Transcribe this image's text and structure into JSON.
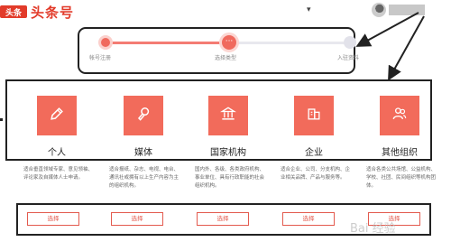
{
  "header": {
    "logo_badge": "头条",
    "logo_text": "头条号",
    "caret": "▾"
  },
  "stepper": {
    "steps": [
      {
        "label": "帐号注册",
        "status": "done"
      },
      {
        "label": "选择类型",
        "status": "current",
        "icon": "···"
      },
      {
        "label": "入驻资料",
        "status": "pending"
      }
    ]
  },
  "categories": [
    {
      "name": "个人",
      "icon": "pencil-icon",
      "desc": "适合垂直领域专家、意见领袖、评论家及自媒体人士申请。"
    },
    {
      "name": "媒体",
      "icon": "microphone-icon",
      "desc": "适合报纸、杂志、电视、电台、通讯社或拥有以上生产内容为主的组织机构。"
    },
    {
      "name": "国家机构",
      "icon": "government-building-icon",
      "desc": "国内外、各级、各类政府机构、事业单位、具有行政职能的社会组织机构。"
    },
    {
      "name": "企业",
      "icon": "company-building-icon",
      "desc": "适合企业、公司、分支机构、企业相关品牌、产品与服务等。"
    },
    {
      "name": "其他组织",
      "icon": "group-icon",
      "desc": "适合各类公共场馆、公益机构、学校、社团、民间组织等机构团体。"
    }
  ],
  "select_label": "选择",
  "watermark": "Bai 经验",
  "colors": {
    "accent": "#f26b5b",
    "brand": "#e23b2a",
    "annotation": "#222222"
  }
}
